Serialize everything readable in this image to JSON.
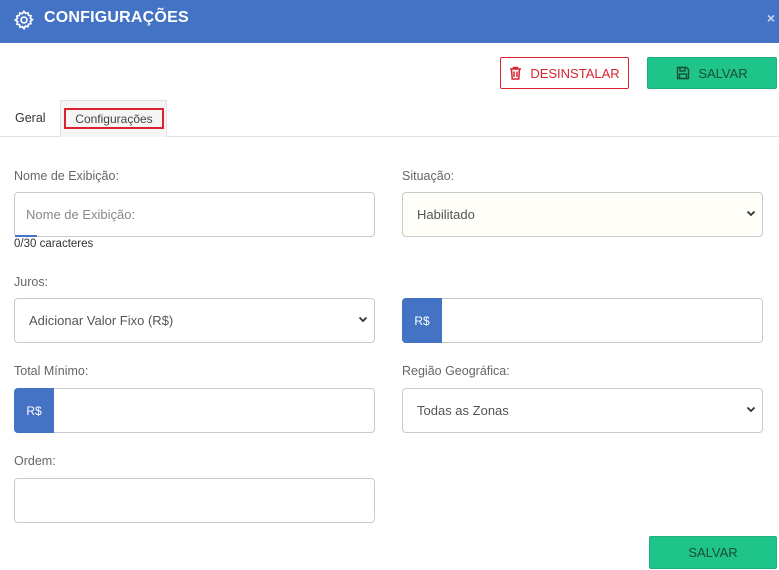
{
  "header": {
    "title": "CONFIGURAÇÕES",
    "close": "×"
  },
  "toolbar": {
    "uninstall_label": "DESINSTALAR",
    "save_label": "SALVAR"
  },
  "tabs": [
    {
      "label": "Geral"
    },
    {
      "label": "Configurações"
    }
  ],
  "form": {
    "display_name": {
      "label": "Nome de Exibição:",
      "placeholder": "Nome de Exibição:",
      "counter": "0/30 caracteres"
    },
    "status": {
      "label": "Situação:",
      "value": "Habilitado"
    },
    "interest": {
      "label": "Juros:",
      "value": "Adicionar Valor Fixo (R$)",
      "prefix": "R$"
    },
    "min_total": {
      "label": "Total Mínimo:",
      "prefix": "R$"
    },
    "region": {
      "label": "Região Geográfica:",
      "value": "Todas as Zonas"
    },
    "order": {
      "label": "Ordem:"
    }
  },
  "footer": {
    "save_label": "SALVAR"
  },
  "colors": {
    "header": "#4472c4",
    "danger": "#d9232e",
    "success": "#1fc48a"
  }
}
